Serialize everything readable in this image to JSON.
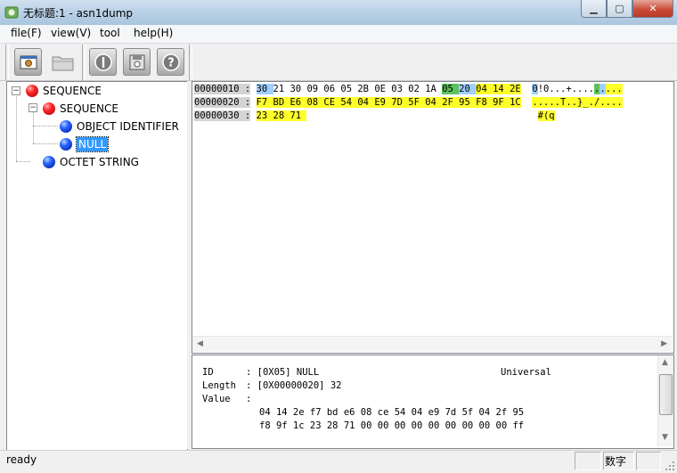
{
  "window": {
    "title": "无标题:1 - asn1dump"
  },
  "menu": {
    "items": [
      "file(F)",
      "view(V)",
      "tool",
      "help(H)"
    ]
  },
  "toolbar": {
    "buttons": [
      "open-document-icon",
      "folder-icon",
      "stop-icon",
      "save-icon",
      "help-icon"
    ]
  },
  "tree": {
    "nodes": [
      {
        "label": "SEQUENCE"
      },
      {
        "label": "SEQUENCE"
      },
      {
        "label": "OBJECT IDENTIFIER"
      },
      {
        "label": "NULL"
      },
      {
        "label": "OCTET STRING"
      }
    ]
  },
  "hex": {
    "rows": [
      {
        "address": "00000010 :",
        "bytes": [
          "30",
          "21",
          "30",
          "09",
          "06",
          "05",
          "2B",
          "0E",
          "03",
          "02",
          "1A",
          "05",
          "20",
          "04",
          "14",
          "2E"
        ],
        "ascii": [
          "0",
          "!",
          "0",
          ".",
          ".",
          ".",
          "+",
          ".",
          ".",
          ".",
          ".",
          ".",
          ".",
          ".",
          ".",
          "."
        ]
      },
      {
        "address": "00000020 :",
        "bytes": [
          "F7",
          "BD",
          "E6",
          "08",
          "CE",
          "54",
          "04",
          "E9",
          "7D",
          "5F",
          "04",
          "2F",
          "95",
          "F8",
          "9F",
          "1C"
        ],
        "ascii": [
          ".",
          ".",
          ".",
          ".",
          ".",
          "T",
          ".",
          ".",
          "}",
          "_",
          ".",
          "/",
          ".",
          ".",
          ".",
          "."
        ]
      },
      {
        "address": "00000030 :",
        "bytes": [
          "23",
          "28",
          "71"
        ],
        "ascii": [
          "#",
          "(",
          "q"
        ]
      }
    ]
  },
  "info": {
    "id_label": "ID",
    "id_value": ": [0X05] NULL",
    "class": "Universal",
    "length_label": "Length",
    "length_value": ": [0X00000020] 32",
    "value_label": "Value",
    "value_colon": ":",
    "value_line1": "04 14 2e f7 bd e6 08 ce 54 04 e9 7d 5f 04 2f 95",
    "value_line2": "f8 9f 1c 23 28 71 00 00 00 00 00 00 00 00 00 ff"
  },
  "status": {
    "text": "ready",
    "numlock": "数字"
  },
  "colors": {
    "highlight_yellow": "#ffff2a",
    "highlight_green": "#5cc25c",
    "highlight_blue": "#9fcfff",
    "selection": "#3399ff"
  }
}
